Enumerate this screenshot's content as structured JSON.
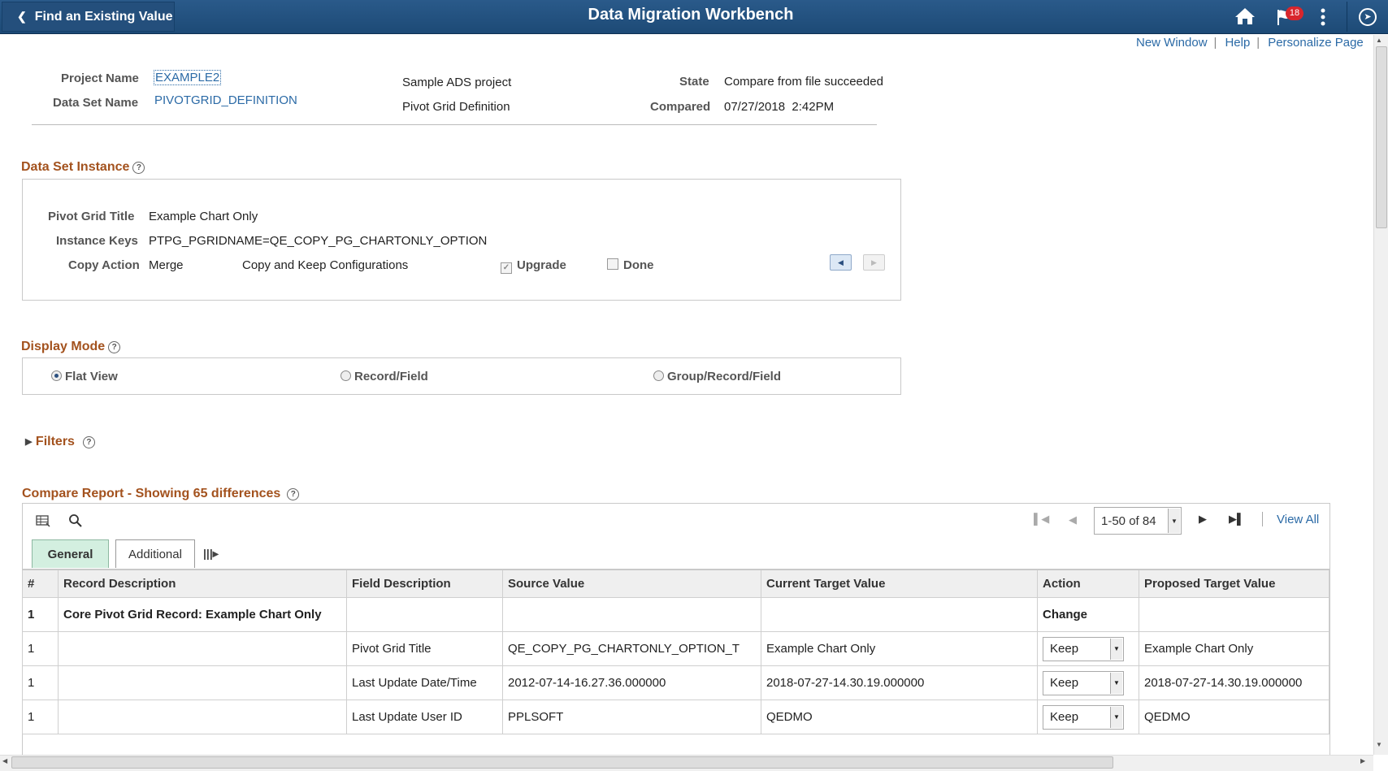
{
  "header": {
    "back_label": "Find an Existing Value",
    "title": "Data Migration Workbench",
    "notification_count": "18",
    "icons": [
      "home-icon",
      "flag-icon",
      "more-actions-icon",
      "navbar-compass-icon"
    ]
  },
  "links": {
    "new_window": "New Window",
    "help": "Help",
    "personalize": "Personalize Page",
    "separator": "|"
  },
  "project": {
    "project_name_label": "Project Name",
    "project_name": "EXAMPLE2",
    "data_set_label": "Data Set Name",
    "data_set_name": "PIVOTGRID_DEFINITION",
    "project_descr": "Sample ADS project",
    "data_set_descr": "Pivot Grid Definition",
    "state_label": "State",
    "state": "Compare from file succeeded",
    "compared_label": "Compared",
    "compared": "07/27/2018  2:42PM"
  },
  "instance": {
    "section_title": "Data Set Instance",
    "pivot_title_label": "Pivot Grid Title",
    "pivot_title": "Example Chart Only",
    "keys_label": "Instance Keys",
    "keys": "PTPG_PGRIDNAME=QE_COPY_PG_CHARTONLY_OPTION",
    "copy_action_label": "Copy Action",
    "copy_action": "Merge",
    "copy_action_descr": "Copy and Keep Configurations",
    "upgrade_label": "Upgrade",
    "upgrade_checked": true,
    "done_label": "Done",
    "done_checked": false
  },
  "display_mode": {
    "section_title": "Display Mode",
    "options": [
      "Flat View",
      "Record/Field",
      "Group/Record/Field"
    ],
    "selected": "Flat View"
  },
  "filters": {
    "section_title": "Filters"
  },
  "compare": {
    "section_title": "Compare Report - Showing 65 differences",
    "pagination": "1-50 of 84",
    "view_all": "View All",
    "tabs": [
      "General",
      "Additional"
    ],
    "active_tab": "General",
    "columns": [
      "#",
      "Record Description",
      "Field Description",
      "Source Value",
      "Current Target Value",
      "Action",
      "Proposed Target Value"
    ],
    "rows": [
      {
        "num": "1",
        "record": "Core Pivot Grid Record: Example Chart Only",
        "field": "",
        "source": "",
        "current": "",
        "action": "Change",
        "proposed": "",
        "bold": true
      },
      {
        "num": "1",
        "record": "",
        "field": "Pivot Grid Title",
        "source": "QE_COPY_PG_CHARTONLY_OPTION_T",
        "current": "Example Chart Only",
        "action": "Keep",
        "proposed": "Example Chart Only"
      },
      {
        "num": "1",
        "record": "",
        "field": "Last Update Date/Time",
        "source": "2012-07-14-16.27.36.000000",
        "current": "2018-07-27-14.30.19.000000",
        "action": "Keep",
        "proposed": "2018-07-27-14.30.19.000000"
      },
      {
        "num": "1",
        "record": "",
        "field": "Last Update User ID",
        "source": "PPLSOFT",
        "current": "QEDMO",
        "action": "Keep",
        "proposed": "QEDMO"
      }
    ]
  }
}
